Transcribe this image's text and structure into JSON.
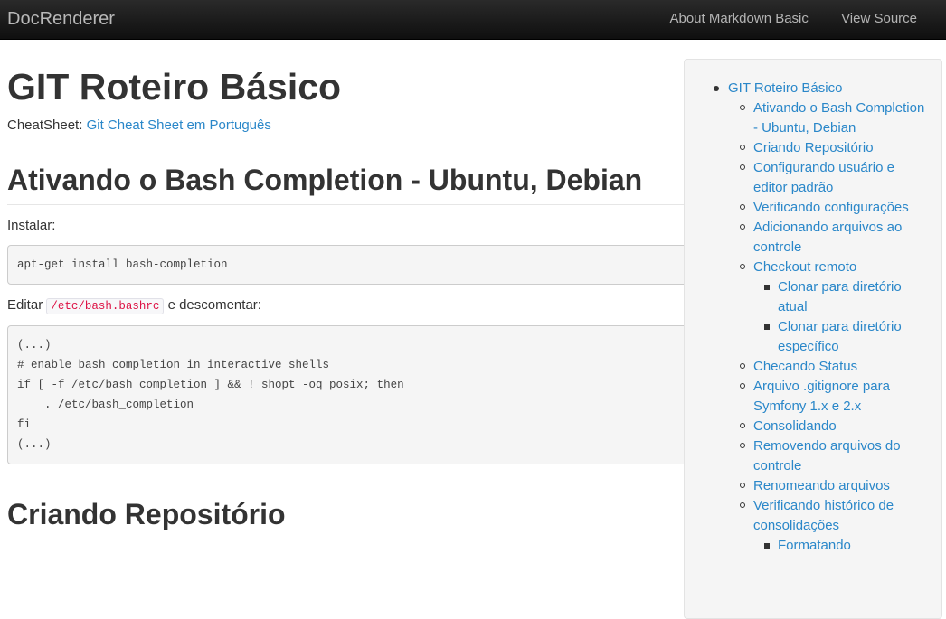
{
  "navbar": {
    "brand": "DocRenderer",
    "links": [
      "About Markdown Basic",
      "View Source"
    ]
  },
  "main": {
    "title": "GIT Roteiro Básico",
    "cheatsheet_label": "CheatSheet:",
    "cheatsheet_link": "Git Cheat Sheet em Português",
    "section1_title": "Ativando o Bash Completion - Ubuntu, Debian",
    "install_label": "Instalar:",
    "install_code": "apt-get install bash-completion",
    "edit_prefix": "Editar",
    "edit_path": "/etc/bash.bashrc",
    "edit_suffix": "e descomentar:",
    "bashrc_code": "(...)\n# enable bash completion in interactive shells\nif [ -f /etc/bash_completion ] && ! shopt -oq posix; then\n    . /etc/bash_completion\nfi\n(...)",
    "section2_title": "Criando Repositório"
  },
  "toc": {
    "root": "GIT Roteiro Básico",
    "items": [
      "Ativando o Bash Completion - Ubuntu, Debian",
      "Criando Repositório",
      "Configurando usuário e editor padrão",
      "Verificando configurações",
      "Adicionando arquivos ao controle",
      "Checkout remoto",
      "Checando Status",
      "Arquivo .gitignore para Symfony 1.x e 2.x",
      "Consolidando",
      "Removendo arquivos do controle",
      "Renomeando arquivos",
      "Verificando histórico de consolidações"
    ],
    "checkout_sub": [
      "Clonar para diretório atual",
      "Clonar para diretório específico"
    ],
    "historico_sub": [
      "Formatando"
    ]
  }
}
